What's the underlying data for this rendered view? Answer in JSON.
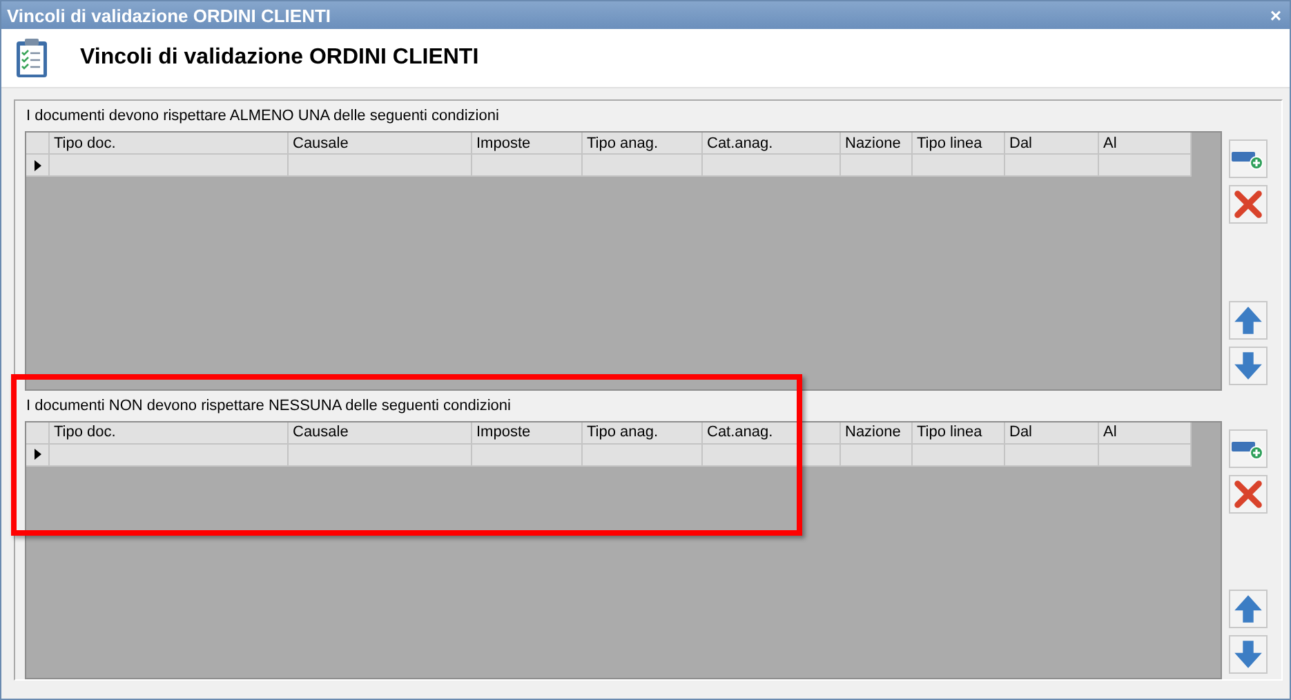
{
  "window": {
    "title": "Vincoli di validazione ORDINI CLIENTI",
    "close": "×"
  },
  "header": {
    "title": "Vincoli di validazione ORDINI CLIENTI"
  },
  "sections": [
    {
      "label": "I documenti devono rispettare ALMENO UNA delle seguenti condizioni",
      "columns": [
        "Tipo doc.",
        "Causale",
        "Imposte",
        "Tipo anag.",
        "Cat.anag.",
        "Nazione",
        "Tipo linea",
        "Dal",
        "Al"
      ],
      "buttons": [
        {
          "kind": "add"
        },
        {
          "kind": "delete"
        },
        {
          "kind": "up"
        },
        {
          "kind": "down"
        }
      ]
    },
    {
      "label": "I documenti NON devono rispettare NESSUNA delle seguenti condizioni",
      "columns": [
        "Tipo doc.",
        "Causale",
        "Imposte",
        "Tipo anag.",
        "Cat.anag.",
        "Nazione",
        "Tipo linea",
        "Dal",
        "Al"
      ],
      "buttons": [
        {
          "kind": "add"
        },
        {
          "kind": "delete"
        },
        {
          "kind": "up"
        },
        {
          "kind": "down"
        }
      ]
    }
  ]
}
